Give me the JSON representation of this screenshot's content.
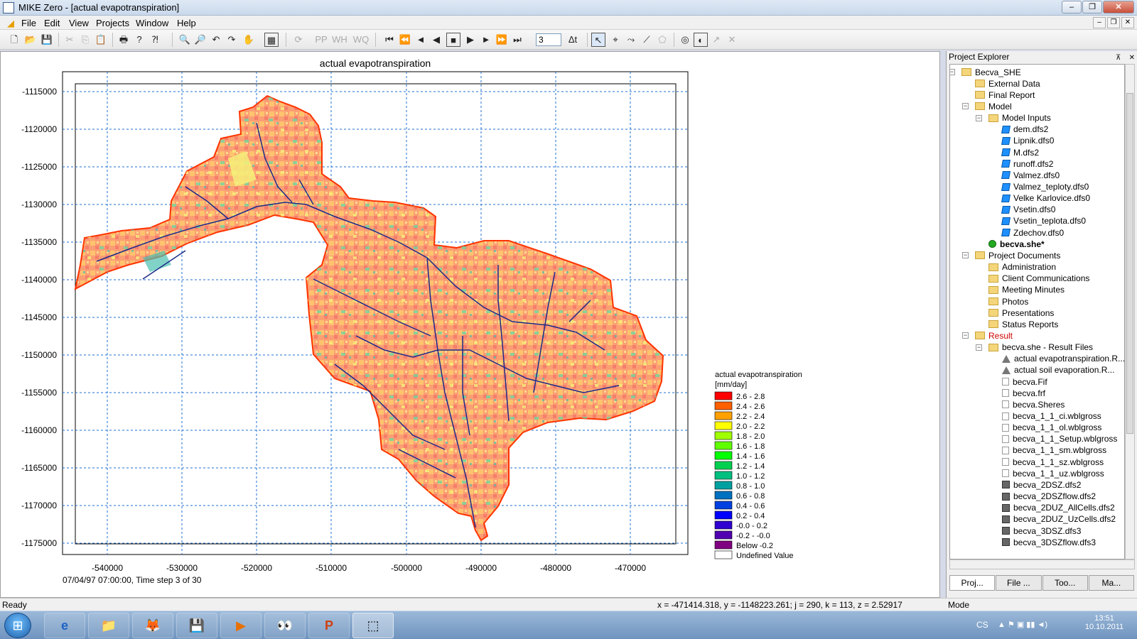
{
  "window": {
    "title": "MIKE Zero - [actual evapotranspiration]",
    "buttons": [
      "–",
      "❐",
      "✕"
    ],
    "mdi_buttons": [
      "–",
      "❐",
      "✕"
    ]
  },
  "menu": [
    "File",
    "Edit",
    "View",
    "Projects",
    "Window",
    "Help"
  ],
  "toolbar": {
    "timestep_value": "3"
  },
  "plot": {
    "title": "actual evapotranspiration",
    "x_ticks": [
      "-540000",
      "-530000",
      "-520000",
      "-510000",
      "-500000",
      "-490000",
      "-480000",
      "-470000"
    ],
    "y_ticks": [
      "-1115000",
      "-1120000",
      "-1125000",
      "-1130000",
      "-1135000",
      "-1140000",
      "-1145000",
      "-1150000",
      "-1155000",
      "-1160000",
      "-1165000",
      "-1170000",
      "-1175000"
    ],
    "time_label": "07/04/97 07:00:00, Time step 3 of 30",
    "legend": {
      "title": "actual evapotranspiration",
      "unit": "[mm/day]",
      "items": [
        {
          "label": "2.6 -  2.8",
          "color": "#ff0000"
        },
        {
          "label": "2.4 -  2.6",
          "color": "#ff6000"
        },
        {
          "label": "2.2 -  2.4",
          "color": "#ffa000"
        },
        {
          "label": "2.0 -  2.2",
          "color": "#ffff00"
        },
        {
          "label": "1.8 -  2.0",
          "color": "#a0ff00"
        },
        {
          "label": "1.6 -  1.8",
          "color": "#60ff00"
        },
        {
          "label": "1.4 -  1.6",
          "color": "#00ff00"
        },
        {
          "label": "1.2 -  1.4",
          "color": "#00d050"
        },
        {
          "label": "1.0 -  1.2",
          "color": "#00c080"
        },
        {
          "label": "0.8 -  1.0",
          "color": "#00a0a0"
        },
        {
          "label": "0.6 -  0.8",
          "color": "#0070c0"
        },
        {
          "label": "0.4 -  0.6",
          "color": "#0040e0"
        },
        {
          "label": "0.2 -  0.4",
          "color": "#0000ff"
        },
        {
          "label": "-0.0 -  0.2",
          "color": "#3000d0"
        },
        {
          "label": "-0.2 - -0.0",
          "color": "#5000b0"
        },
        {
          "label": "Below -0.2",
          "color": "#800080"
        },
        {
          "label": "Undefined Value",
          "color": "#ffffff"
        }
      ]
    }
  },
  "status": {
    "ready": "Ready",
    "coords": "x = -471414.318, y = -1148223.261; j = 290, k = 113, z = 2.52917",
    "mode": "Mode"
  },
  "explorer": {
    "title": "Project Explorer",
    "pin": "⊼",
    "close": "✕",
    "tree": [
      {
        "label": "Becva_SHE",
        "level": 0,
        "icon": "folder",
        "expander": "−"
      },
      {
        "label": "External Data",
        "level": 1,
        "icon": "folder"
      },
      {
        "label": "Final Report",
        "level": 1,
        "icon": "folder"
      },
      {
        "label": "Model",
        "level": 1,
        "icon": "folder",
        "expander": "−"
      },
      {
        "label": "Model Inputs",
        "level": 2,
        "icon": "folder",
        "expander": "−"
      },
      {
        "label": "dem.dfs2",
        "level": 3,
        "icon": "dfs0"
      },
      {
        "label": "Lipnik.dfs0",
        "level": 3,
        "icon": "dfs0"
      },
      {
        "label": "M.dfs2",
        "level": 3,
        "icon": "dfs0"
      },
      {
        "label": "runoff.dfs2",
        "level": 3,
        "icon": "dfs0"
      },
      {
        "label": "Valmez.dfs0",
        "level": 3,
        "icon": "dfs0"
      },
      {
        "label": "Valmez_teploty.dfs0",
        "level": 3,
        "icon": "dfs0"
      },
      {
        "label": "Velke Karlovice.dfs0",
        "level": 3,
        "icon": "dfs0"
      },
      {
        "label": "Vsetin.dfs0",
        "level": 3,
        "icon": "dfs0"
      },
      {
        "label": "Vsetin_teplota.dfs0",
        "level": 3,
        "icon": "dfs0"
      },
      {
        "label": "Zdechov.dfs0",
        "level": 3,
        "icon": "dfs0"
      },
      {
        "label": "becva.she*",
        "level": 2,
        "icon": "green",
        "bold": true
      },
      {
        "label": "Project Documents",
        "level": 1,
        "icon": "folder",
        "expander": "−"
      },
      {
        "label": "Administration",
        "level": 2,
        "icon": "folder"
      },
      {
        "label": "Client Communications",
        "level": 2,
        "icon": "folder"
      },
      {
        "label": "Meeting Minutes",
        "level": 2,
        "icon": "folder"
      },
      {
        "label": "Photos",
        "level": 2,
        "icon": "folder"
      },
      {
        "label": "Presentations",
        "level": 2,
        "icon": "folder"
      },
      {
        "label": "Status Reports",
        "level": 2,
        "icon": "folder"
      },
      {
        "label": "Result",
        "level": 1,
        "icon": "folder",
        "expander": "−",
        "red": true
      },
      {
        "label": "becva.she - Result Files",
        "level": 2,
        "icon": "folder",
        "expander": "−"
      },
      {
        "label": "actual evapotranspiration.R...",
        "level": 3,
        "icon": "tri"
      },
      {
        "label": "actual soil  evaporation.R...",
        "level": 3,
        "icon": "tri"
      },
      {
        "label": "becva.Fif",
        "level": 3,
        "icon": "file"
      },
      {
        "label": "becva.frf",
        "level": 3,
        "icon": "file"
      },
      {
        "label": "becva.Sheres",
        "level": 3,
        "icon": "file"
      },
      {
        "label": "becva_1_1_ci.wblgross",
        "level": 3,
        "icon": "file"
      },
      {
        "label": "becva_1_1_ol.wblgross",
        "level": 3,
        "icon": "file"
      },
      {
        "label": "becva_1_1_Setup.wblgross",
        "level": 3,
        "icon": "file"
      },
      {
        "label": "becva_1_1_sm.wblgross",
        "level": 3,
        "icon": "file"
      },
      {
        "label": "becva_1_1_sz.wblgross",
        "level": 3,
        "icon": "file"
      },
      {
        "label": "becva_1_1_uz.wblgross",
        "level": 3,
        "icon": "file"
      },
      {
        "label": "becva_2DSZ.dfs2",
        "level": 3,
        "icon": "grid"
      },
      {
        "label": "becva_2DSZflow.dfs2",
        "level": 3,
        "icon": "grid"
      },
      {
        "label": "becva_2DUZ_AllCells.dfs2",
        "level": 3,
        "icon": "grid"
      },
      {
        "label": "becva_2DUZ_UzCells.dfs2",
        "level": 3,
        "icon": "grid"
      },
      {
        "label": "becva_3DSZ.dfs3",
        "level": 3,
        "icon": "grid"
      },
      {
        "label": "becva_3DSZflow.dfs3",
        "level": 3,
        "icon": "grid"
      }
    ],
    "tabs": [
      "Proj...",
      "File ...",
      "Too...",
      "Ma..."
    ]
  },
  "taskbar": {
    "start": "⊞",
    "apps": [
      "e",
      "📁",
      "🦊",
      "💾",
      "▶",
      "👀",
      "P",
      "⬚"
    ],
    "lang": "CS",
    "tray_icons": "▲ ⚑ ▣ ▮▮ ◄)",
    "time": "13:51",
    "date": "10.10.2011"
  }
}
